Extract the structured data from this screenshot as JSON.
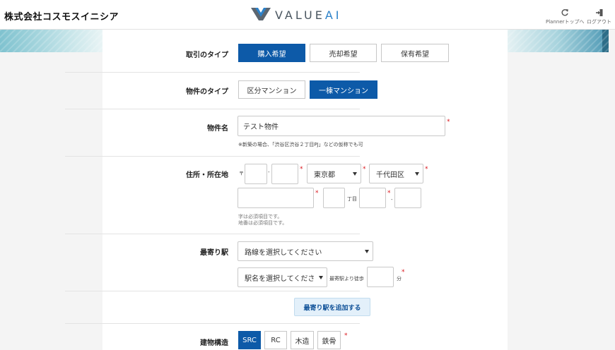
{
  "header": {
    "company": "株式会社コスモスイニシア",
    "brand_main": "VALUE",
    "brand_ai": "AI",
    "planner_label": "Plannerトップへ",
    "logout_label": "ログアウト"
  },
  "form": {
    "transaction_type": {
      "label": "取引のタイプ",
      "options": [
        "購入希望",
        "売却希望",
        "保有希望"
      ],
      "selected": "購入希望"
    },
    "property_type": {
      "label": "物件のタイプ",
      "options": [
        "区分マンション",
        "一棟マンション"
      ],
      "selected": "一棟マンション"
    },
    "property_name": {
      "label": "物件名",
      "value": "テスト物件",
      "required_mark": "*",
      "note": "※新築の場合、「渋谷区渋谷２丁目PJ」などの仮称でも可"
    },
    "address": {
      "label": "住所・所在地",
      "postal_mark": "〒",
      "postal_sep": "-",
      "postal1": "",
      "postal2": "",
      "prefecture": "東京都",
      "city": "千代田区",
      "town": "",
      "chome": "",
      "chome_suffix": "丁目",
      "block1": "",
      "block_sep": "-",
      "block2": "",
      "note1": "字は必須項目です。",
      "note2": "地番は必須項目です。"
    },
    "station": {
      "label": "最寄り駅",
      "line_placeholder": "路線を選択してください",
      "station_placeholder": "駅名を選択してくださ",
      "walk_label": "最寄駅より徒歩",
      "walk_value": "",
      "minutes_suffix": "分",
      "add_button": "最寄り駅を追加する"
    },
    "structure": {
      "label": "建物構造",
      "options": [
        "SRC",
        "RC",
        "木造",
        "鉄骨"
      ],
      "selected": "SRC"
    }
  },
  "colors": {
    "primary": "#0d5aa8",
    "required": "#d9161c",
    "brand_ai": "#2d82c9"
  }
}
